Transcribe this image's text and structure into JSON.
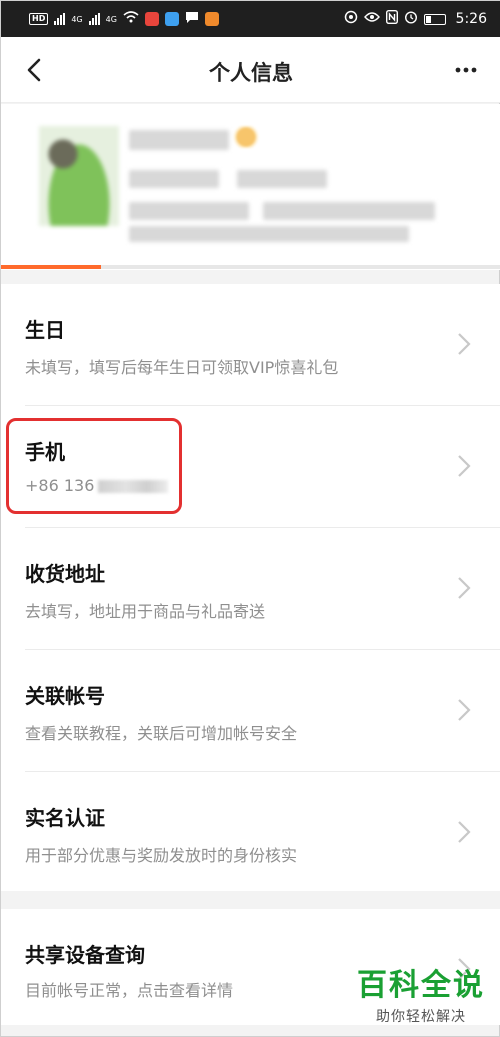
{
  "status_bar": {
    "hd": "HD",
    "net1": "4G",
    "net2": "4G",
    "time": "5:26"
  },
  "nav": {
    "title": "个人信息"
  },
  "items": [
    {
      "title": "生日",
      "sub": "未填写，填写后每年生日可领取VIP惊喜礼包"
    },
    {
      "title": "手机",
      "sub": "+86 136"
    },
    {
      "title": "收货地址",
      "sub": "去填写，地址用于商品与礼品寄送"
    },
    {
      "title": "关联帐号",
      "sub": "查看关联教程，关联后可增加帐号安全"
    },
    {
      "title": "实名认证",
      "sub": "用于部分优惠与奖励发放时的身份核实"
    },
    {
      "title": "共享设备查询",
      "sub": "目前帐号正常，点击查看详情"
    }
  ],
  "watermark": {
    "title": "百科全说",
    "sub": "助你轻松解决"
  },
  "colors": {
    "accent": "#ff6a2c",
    "highlight": "#e33030",
    "watermark": "#1aa033"
  },
  "profile_tab_progress": 0.2
}
